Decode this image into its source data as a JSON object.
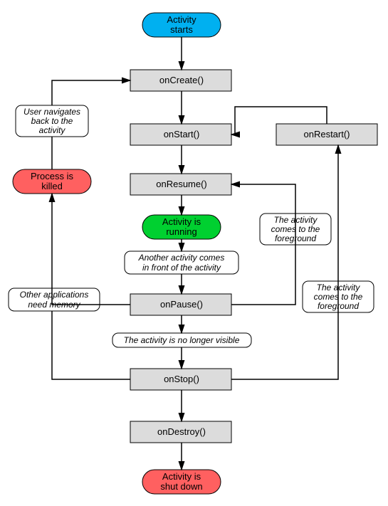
{
  "nodes": {
    "start1": "Activity",
    "start2": "starts",
    "onCreate": "onCreate()",
    "onStart": "onStart()",
    "onRestart": "onRestart()",
    "onResume": "onResume()",
    "running1": "Activity is",
    "running2": "running",
    "onPause": "onPause()",
    "onStop": "onStop()",
    "onDestroy": "onDestroy()",
    "shutdown1": "Activity is",
    "shutdown2": "shut down",
    "killed1": "Process is",
    "killed2": "killed"
  },
  "notes": {
    "userBack1": "User navigates",
    "userBack2": "back to the",
    "userBack3": "activity",
    "another1": "Another activity comes",
    "another2": "in front of the activity",
    "noLonger": "The activity is no longer visible",
    "otherMem1": "Other applications",
    "otherMem2": "need memory",
    "fg1a": "The activity",
    "fg1b": "comes to the",
    "fg1c": "foreground",
    "fg2a": "The activity",
    "fg2b": "comes to the",
    "fg2c": "foreground"
  }
}
